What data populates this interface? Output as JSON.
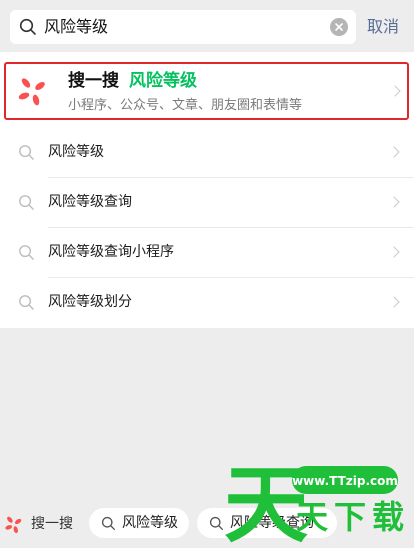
{
  "search": {
    "query": "风险等级",
    "cancel_label": "取消"
  },
  "souyisou": {
    "brand": "搜一搜",
    "keyword": "风险等级",
    "subtitle": "小程序、公众号、文章、朋友圈和表情等"
  },
  "suggestions": [
    {
      "label": "风险等级"
    },
    {
      "label": "风险等级查询"
    },
    {
      "label": "风险等级查询小程序"
    },
    {
      "label": "风险等级划分"
    }
  ],
  "bottom": {
    "label": "搜一搜",
    "chips": [
      {
        "label": "风险等级"
      },
      {
        "label": "风险等级查询"
      }
    ]
  },
  "watermark": {
    "char": "天",
    "url": "www.TTzip.com",
    "text": "天下载"
  },
  "colors": {
    "accent_green": "#07c160",
    "link_blue": "#576b95",
    "highlight_red": "#e0272c",
    "logo_red": "#fa5151"
  }
}
